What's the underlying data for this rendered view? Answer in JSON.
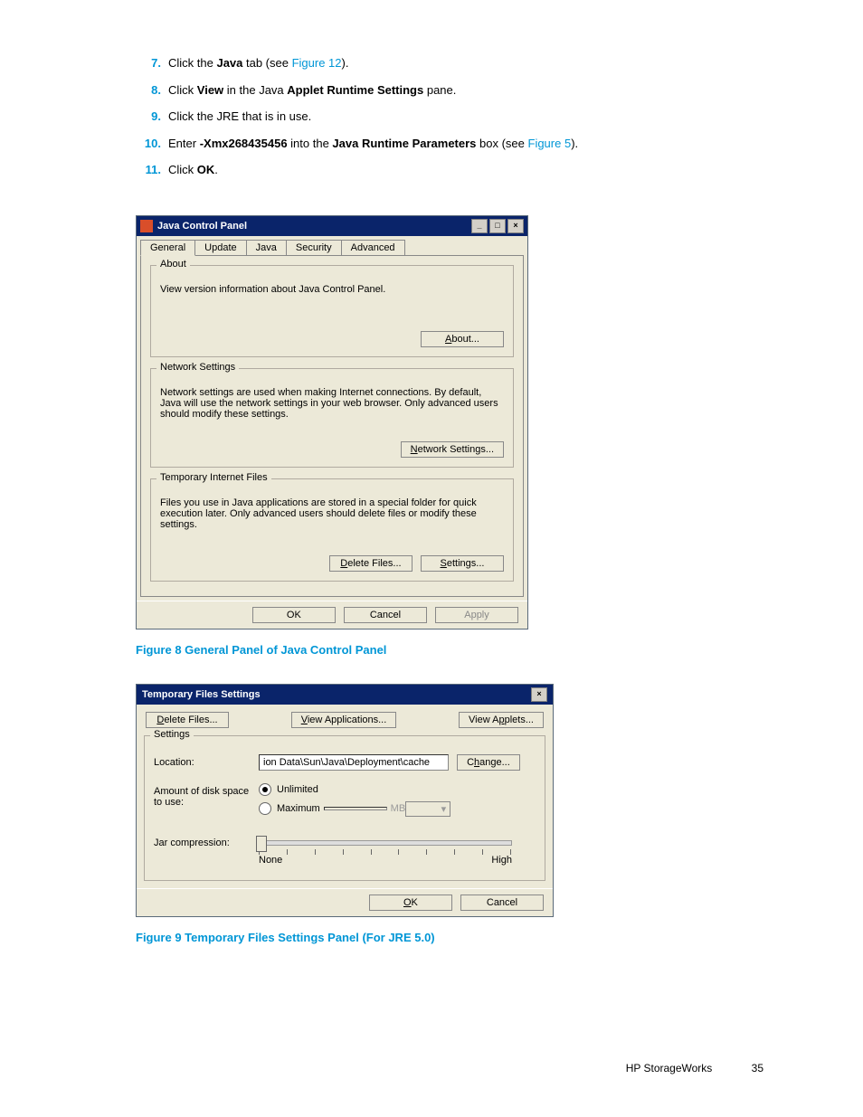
{
  "steps": [
    {
      "num": "7.",
      "pre": "Click the ",
      "b1": "Java",
      "mid": " tab (see ",
      "link": "Figure 12",
      "post": ")."
    },
    {
      "num": "8.",
      "pre": "Click ",
      "b1": "View",
      "mid": " in the Java ",
      "b2": "Applet Runtime Settings",
      "post": " pane."
    },
    {
      "num": "9.",
      "plain": "Click the JRE that is in use."
    },
    {
      "num": "10.",
      "pre": "Enter ",
      "b1": "-Xmx268435456",
      "mid": " into the ",
      "b2": "Java Runtime Parameters",
      "mid2": " box (see ",
      "link": "Figure 5",
      "post": ")."
    },
    {
      "num": "11.",
      "pre": "Click ",
      "b1": "OK",
      "post": "."
    }
  ],
  "jcp": {
    "title": "Java Control Panel",
    "tabs": [
      "General",
      "Update",
      "Java",
      "Security",
      "Advanced"
    ],
    "about": {
      "legend": "About",
      "text": "View version information about Java Control Panel.",
      "btn": "About..."
    },
    "net": {
      "legend": "Network Settings",
      "text": "Network settings are used when making Internet connections.  By default, Java will use the network settings in your web browser.  Only advanced users should modify these settings.",
      "btn": "Network Settings..."
    },
    "tmp": {
      "legend": "Temporary Internet Files",
      "text": "Files you use in Java applications are stored in a special folder for quick execution later.  Only advanced users should delete files or modify these settings.",
      "delete_btn": "Delete Files...",
      "settings_btn": "Settings..."
    },
    "ok": "OK",
    "cancel": "Cancel",
    "apply": "Apply"
  },
  "caption8": "Figure 8 General Panel of Java Control Panel",
  "tfs": {
    "title": "Temporary Files Settings",
    "top": {
      "delete": "Delete Files...",
      "viewapps": "View Applications...",
      "viewapplets": "View Applets..."
    },
    "settings_legend": "Settings",
    "location_label": "Location:",
    "location_value": "ion Data\\Sun\\Java\\Deployment\\cache",
    "change": "Change...",
    "disk_label": "Amount of disk space to use:",
    "unlimited": "Unlimited",
    "maximum": "Maximum",
    "mb": "MB",
    "jar_label": "Jar compression:",
    "slider_low": "None",
    "slider_high": "High",
    "ok": "OK",
    "cancel": "Cancel"
  },
  "caption9": "Figure 9 Temporary Files Settings Panel (For JRE 5.0)",
  "footer": {
    "text": "HP StorageWorks",
    "page": "35"
  }
}
